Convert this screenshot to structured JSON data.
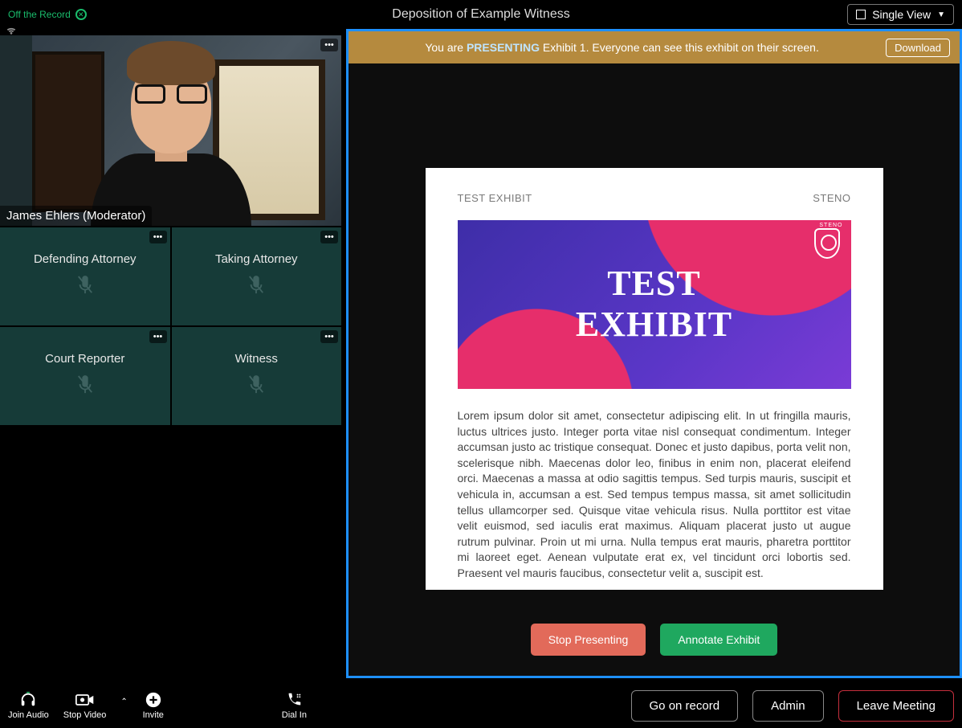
{
  "header": {
    "record_status": "Off the Record",
    "meeting_title": "Deposition of Example Witness",
    "view_mode": "Single View"
  },
  "speaker": {
    "name_label": "James Ehlers (Moderator)"
  },
  "participants": [
    {
      "role": "Defending Attorney"
    },
    {
      "role": "Taking Attorney"
    },
    {
      "role": "Court Reporter"
    },
    {
      "role": "Witness"
    }
  ],
  "presenting": {
    "prefix": "You are ",
    "highlight": "PRESENTING",
    "suffix": " Exhibit 1. Everyone can see this exhibit on their screen.",
    "download": "Download"
  },
  "document": {
    "left_head": "TEST EXHIBIT",
    "right_head": "STENO",
    "banner_badge": "STENO",
    "banner_line1": "TEST",
    "banner_line2": "EXHIBIT",
    "lorem": "Lorem ipsum dolor sit amet, consectetur adipiscing elit. In ut fringilla mauris, luctus ultrices justo. Integer porta vitae nisl consequat condimentum. Integer accumsan justo ac tristique consequat. Donec et justo dapibus, porta velit non, scelerisque nibh. Maecenas dolor leo, finibus in enim non, placerat eleifend orci. Maecenas a massa at odio sagittis tempus. Sed turpis mauris, suscipit et vehicula in, accumsan a est. Sed tempus tempus massa, sit amet sollicitudin tellus ullamcorper sed. Quisque vitae vehicula risus. Nulla porttitor est vitae velit euismod, sed iaculis erat maximus. Aliquam placerat justo ut augue rutrum pulvinar. Proin ut mi urna. Nulla tempus erat mauris, pharetra porttitor mi laoreet eget. Aenean vulputate erat ex, vel tincidunt orci lobortis sed. Praesent vel mauris faucibus, consectetur velit a, suscipit est."
  },
  "exhibit_actions": {
    "stop": "Stop Presenting",
    "annotate": "Annotate Exhibit"
  },
  "bottombar": {
    "join_audio": "Join Audio",
    "stop_video": "Stop Video",
    "invite": "Invite",
    "dial_in": "Dial In",
    "go_on_record": "Go on record",
    "admin": "Admin",
    "leave": "Leave Meeting"
  }
}
